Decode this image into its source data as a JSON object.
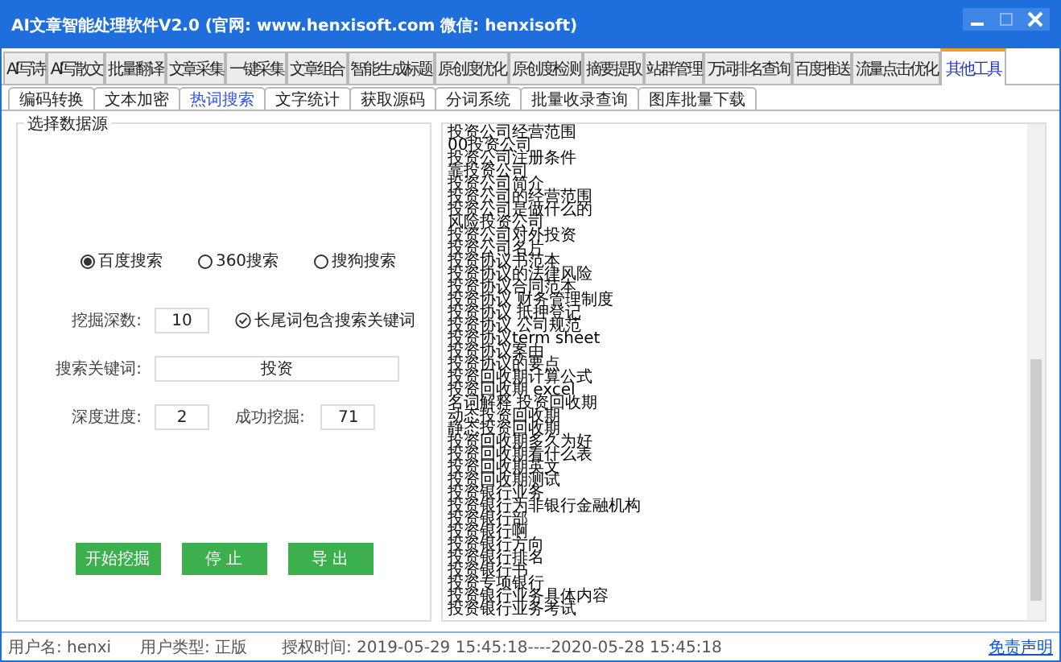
{
  "window": {
    "title": "AI文章智能处理软件V2.0 (官网: www.henxisoft.com  微信: henxisoft)"
  },
  "tabs": [
    {
      "label": "AI写诗",
      "selected": false
    },
    {
      "label": "AI写散文",
      "selected": false
    },
    {
      "label": "批量翻译",
      "selected": false
    },
    {
      "label": "文章采集",
      "selected": false
    },
    {
      "label": "一键采集",
      "selected": false
    },
    {
      "label": "文章组合",
      "selected": false
    },
    {
      "label": "智能生成标题",
      "selected": false
    },
    {
      "label": "原创度优化",
      "selected": false
    },
    {
      "label": "原创度检测",
      "selected": false
    },
    {
      "label": "摘要提取",
      "selected": false
    },
    {
      "label": "站群管理",
      "selected": false
    },
    {
      "label": "万词排名查询",
      "selected": false
    },
    {
      "label": "百度推送",
      "selected": false
    },
    {
      "label": "流量点击优化",
      "selected": false
    },
    {
      "label": "其他工具",
      "selected": true
    }
  ],
  "subtabs": [
    {
      "label": "编码转换",
      "selected": false
    },
    {
      "label": "文本加密",
      "selected": false
    },
    {
      "label": "热词搜索",
      "selected": true
    },
    {
      "label": "文字统计",
      "selected": false
    },
    {
      "label": "获取源码",
      "selected": false
    },
    {
      "label": "分词系统",
      "selected": false
    },
    {
      "label": "批量收录查询",
      "selected": false
    },
    {
      "label": "图库批量下载",
      "selected": false
    }
  ],
  "group": {
    "title": "选择数据源",
    "engines": [
      {
        "label": "百度搜索",
        "selected": true
      },
      {
        "label": "360搜索",
        "selected": false
      },
      {
        "label": "搜狗搜索",
        "selected": false
      }
    ],
    "depth": {
      "label": "挖掘深数:",
      "value": "10"
    },
    "longtail": {
      "label": "长尾词包含搜索关键词",
      "checked": true
    },
    "keyword": {
      "label": "搜索关键词:",
      "value": "投资"
    },
    "progress": {
      "label": "深度进度:",
      "value": "2"
    },
    "success": {
      "label": "成功挖掘:",
      "value": "71"
    },
    "buttons": [
      "开始挖掘",
      "停 止",
      "导 出"
    ]
  },
  "results": [
    "投资公司经营范围",
    "00投资公司",
    "投资公司注册条件",
    "靠投资公司",
    "投资公司简介",
    "投资公司的经营范围",
    "投资公司是做什么的",
    "风险投资公司",
    "投资公司对外投资",
    "投资公司名片",
    "投资协议书范本",
    "投资协议的法律风险",
    "投资协议合同范本",
    "投资协议 财务管理制度",
    "投资协议 抵押登记",
    "投资协议 公司规范",
    "投资协议term sheet",
    "投资协议案由",
    "投资协议的要点",
    "投资回收期计算公式",
    "投资回收期 excel",
    "名词解释 投资回收期",
    "动态投资回收期",
    "静态投资回收期",
    "投资回收期多久为好",
    "投资回收期看什么表",
    "投资回收期英文",
    "投资回收期测试",
    "投资银行业务",
    "投资银行为非银行金融机构",
    "投资银行部",
    "投资银行啊",
    "投资银行方向",
    "投资银行排名",
    "投资银行书",
    "投资专项银行",
    "投资银行业务具体内容",
    "投资银行业务考试"
  ],
  "status_bar": {
    "user": "用户名: henxi",
    "type": "用户类型: 正版",
    "license": "授权时间: 2019-05-29 15:45:18----2020-05-28 15:45:18",
    "link": "免责声明"
  }
}
